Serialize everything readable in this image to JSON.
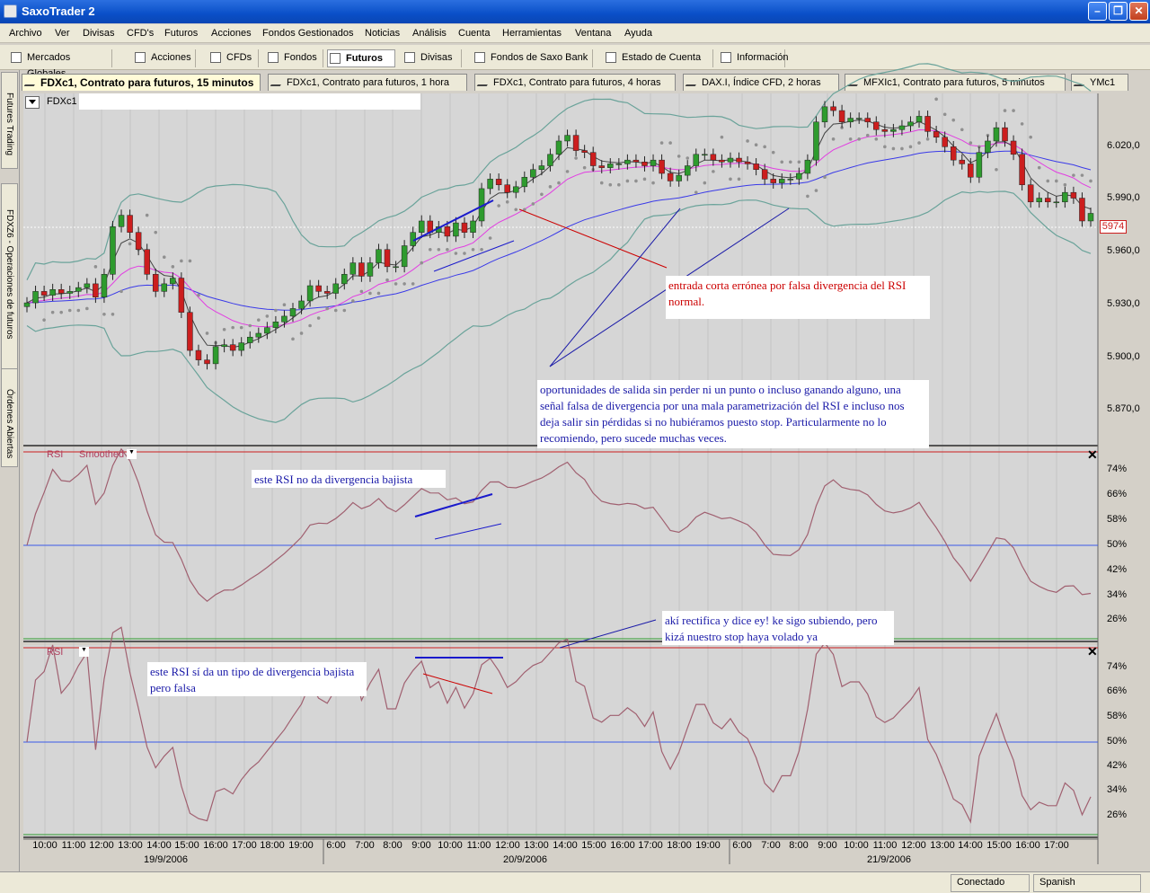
{
  "window": {
    "title": "SaxoTrader 2"
  },
  "menu": [
    "Archivo",
    "Ver",
    "Divisas",
    "CFD's",
    "Futuros",
    "Acciones",
    "Fondos Gestionados",
    "Noticias",
    "Análisis",
    "Cuenta",
    "Herramientas",
    "Ventana",
    "Ayuda"
  ],
  "toolbar": [
    "Mercados Globales",
    "Acciones",
    "CFDs",
    "Fondos",
    "Futuros",
    "Divisas",
    "Fondos de Saxo Bank",
    "Estado de Cuenta",
    "Información"
  ],
  "toolbar_active": "Futuros",
  "left_tabs": [
    "Futures Trading",
    "FDXZ6 - Operaciones de futuros",
    "Órdenes Abiertas"
  ],
  "chart_tabs": [
    "FDXc1, Contrato para futuros, 15 minutos",
    "FDXc1, Contrato para futuros, 1 hora",
    "FDXc1, Contrato para futuros, 4 horas",
    "DAX.I, Índice CFD, 2 horas",
    "MFXIc1, Contrato para futuros, 5 minutos",
    "YMc1"
  ],
  "instrument": "FDXc1",
  "price_axis": [
    "6.020,0",
    "5.990,0",
    "5.960,0",
    "5.930,0",
    "5.900,0",
    "5.870,0"
  ],
  "current_price": "5974",
  "rsi_axis": [
    "74%",
    "66%",
    "58%",
    "50%",
    "42%",
    "34%",
    "26%"
  ],
  "rsi_smoothed_label": "RSI",
  "rsi_smoothed_suffix": "Smoothed",
  "rsi_label": "RSI",
  "time_labels": [
    "10:00",
    "11:00",
    "12:00",
    "13:00",
    "14:00",
    "15:00",
    "16:00",
    "17:00",
    "18:00",
    "19:00",
    "6:00",
    "7:00",
    "8:00",
    "9:00",
    "10:00",
    "11:00",
    "12:00",
    "13:00",
    "14:00",
    "15:00",
    "16:00",
    "17:00",
    "18:00",
    "19:00",
    "6:00",
    "7:00",
    "8:00",
    "9:00",
    "10:00",
    "11:00",
    "12:00",
    "13:00",
    "14:00",
    "15:00",
    "16:00",
    "17:00"
  ],
  "dates": [
    "19/9/2006",
    "20/9/2006",
    "21/9/2006"
  ],
  "annotations": {
    "entrada": "entrada corta errónea por falsa divergencia del RSI normal.",
    "oportunidades": "oportunidades de salida sin perder ni un punto o incluso ganando alguno, una señal falsa de divergencia por una mala parametrización del RSI e incluso nos deja salir sin pérdidas si no hubiéramos puesto stop. Particularmente no lo recomiendo, pero sucede muchas veces.",
    "no_div": "este RSI no da divergencia bajista",
    "si_div": "este RSI sí da un tipo de divergencia bajista pero falsa",
    "rectifica": "akí rectifica y dice ey! ke sigo subiendo, pero kizá nuestro stop haya volado ya"
  },
  "status": {
    "connection": "Conectado",
    "language": "Spanish"
  },
  "colors": {
    "bull": "#2e9b2e",
    "bear": "#cc1e1e",
    "bands": "#6aa39a",
    "ema_fast": "#e23ee2",
    "ema_slow": "#3a3ae8",
    "sar": "#909090",
    "rsi": "#a06070",
    "note_red": "#cc0000",
    "note_blue": "#1a1aa8"
  },
  "chart_data": {
    "type": "candlestick",
    "y_range": [
      5850,
      6035
    ],
    "close": [
      5925,
      5931,
      5929,
      5932,
      5930,
      5931,
      5933,
      5935,
      5928,
      5940,
      5965,
      5971,
      5962,
      5953,
      5940,
      5931,
      5935,
      5938,
      5920,
      5900,
      5895,
      5893,
      5902,
      5903,
      5900,
      5904,
      5907,
      5909,
      5912,
      5915,
      5918,
      5922,
      5926,
      5934,
      5931,
      5930,
      5935,
      5940,
      5946,
      5939,
      5946,
      5953,
      5944,
      5944,
      5955,
      5962,
      5968,
      5962,
      5965,
      5960,
      5967,
      5962,
      5968,
      5985,
      5990,
      5987,
      5983,
      5986,
      5991,
      5995,
      5997,
      6003,
      6010,
      6013,
      6005,
      6004,
      5997,
      5996,
      5998,
      5998,
      6000,
      5999,
      5997,
      6000,
      5993,
      5989,
      5992,
      5997,
      6003,
      6003,
      6000,
      5999,
      6001,
      5999,
      5998,
      5995,
      5990,
      5988,
      5990,
      5990,
      5993,
      6000,
      6020,
      6028,
      6026,
      6020,
      6022,
      6022,
      6020,
      6016,
      6015,
      6016,
      6018,
      6020,
      6023,
      6015,
      6012,
      6007,
      6000,
      5998,
      5991,
      6004,
      6010,
      6017,
      6010,
      6003,
      5987,
      5978,
      5980,
      5978,
      5978,
      5983,
      5980,
      5968,
      5972
    ]
  }
}
